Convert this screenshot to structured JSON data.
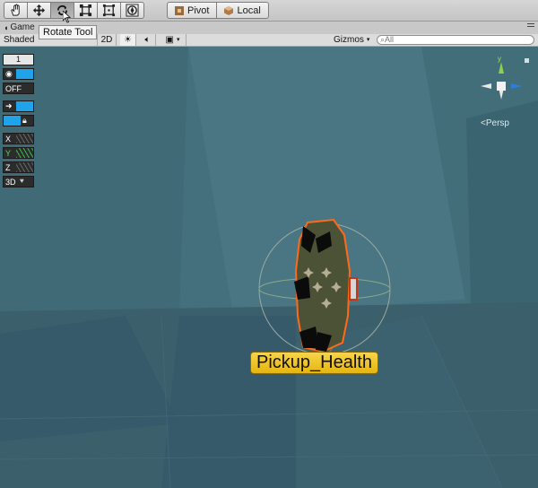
{
  "toolbar": {
    "tools": [
      {
        "name": "hand-tool",
        "icon": "hand-icon"
      },
      {
        "name": "move-tool",
        "icon": "move-icon"
      },
      {
        "name": "rotate-tool",
        "icon": "rotate-icon",
        "active": true
      },
      {
        "name": "scale-tool",
        "icon": "scale-icon"
      },
      {
        "name": "rect-tool",
        "icon": "rect-icon"
      },
      {
        "name": "transform-tool",
        "icon": "transform-icon"
      }
    ],
    "pivot_label": "Pivot",
    "local_label": "Local"
  },
  "tooltip": {
    "text": "Rotate Tool"
  },
  "tab": {
    "label": "Game"
  },
  "scenebar": {
    "shading": "Shaded",
    "mode_2d": "2D",
    "gizmos": "Gizmos",
    "search_placeholder": "All"
  },
  "left_tools": {
    "layer_value": "1",
    "off_label": "OFF",
    "x_label": "X",
    "y_label": "Y",
    "z_label": "Z",
    "d3_label": "3D"
  },
  "gizmo": {
    "y_label": "y",
    "persp_label": "Persp"
  },
  "object": {
    "label": "Pickup_Health"
  },
  "colors": {
    "viewport": "#3f6673",
    "accent_blue": "#1fa3ea",
    "label_yellow": "#f0c632",
    "selection_orange": "#ff6a1a"
  }
}
